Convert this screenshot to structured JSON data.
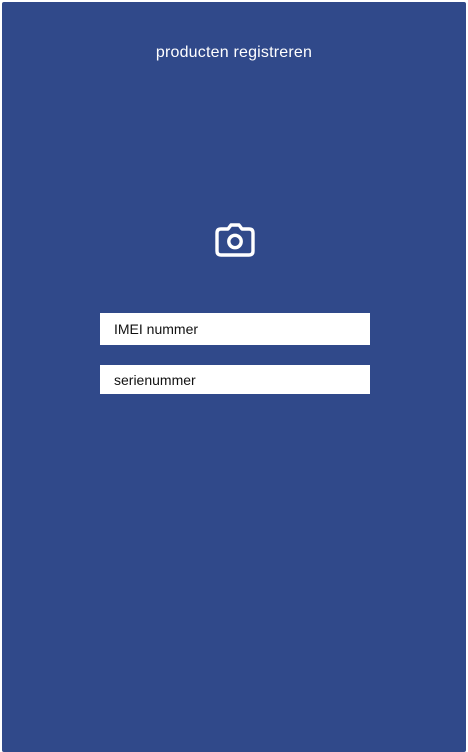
{
  "header": {
    "title": "producten registreren"
  },
  "camera": {
    "icon": "camera-icon"
  },
  "form": {
    "imei_placeholder": "IMEI nummer",
    "serial_placeholder": "serienummer"
  },
  "colors": {
    "background": "#30498a",
    "field_background": "#ffffff",
    "text_light": "#ffffff",
    "text_dark": "#111111"
  }
}
